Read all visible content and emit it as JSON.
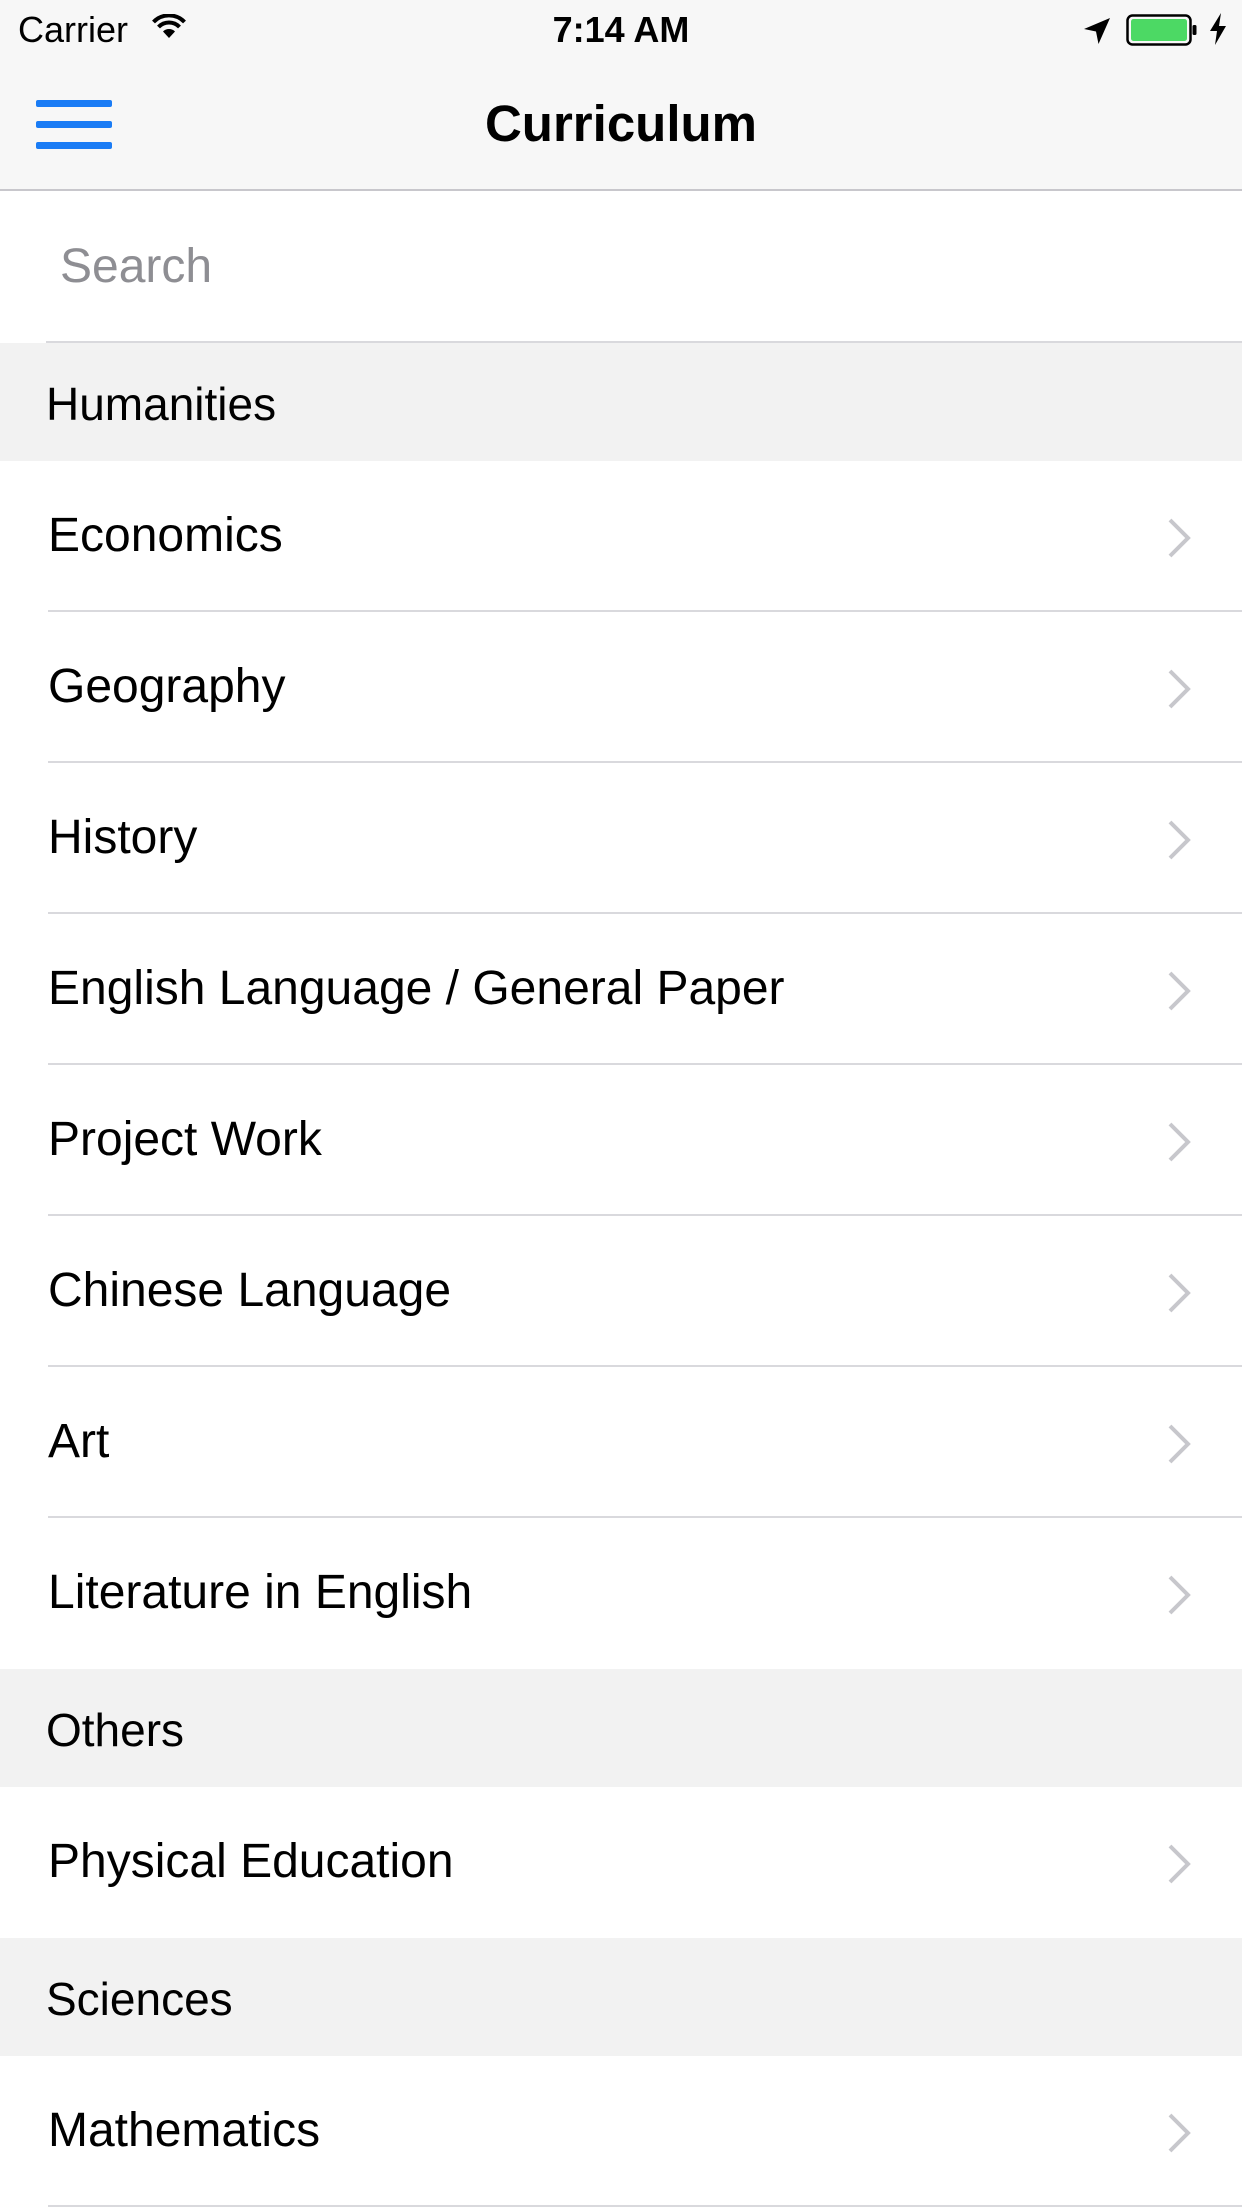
{
  "status_bar": {
    "carrier": "Carrier",
    "time": "7:14 AM",
    "battery_color": "#4cd964"
  },
  "nav_bar": {
    "title": "Curriculum",
    "menu_icon": "hamburger-icon",
    "accent_color": "#1a7cf5"
  },
  "search": {
    "placeholder": "Search",
    "value": ""
  },
  "sections": [
    {
      "title": "Humanities",
      "items": [
        {
          "label": "Economics"
        },
        {
          "label": "Geography"
        },
        {
          "label": "History"
        },
        {
          "label": "English Language / General Paper"
        },
        {
          "label": "Project Work"
        },
        {
          "label": "Chinese Language"
        },
        {
          "label": "Art"
        },
        {
          "label": "Literature in English"
        }
      ]
    },
    {
      "title": "Others",
      "items": [
        {
          "label": "Physical Education"
        }
      ]
    },
    {
      "title": "Sciences",
      "items": [
        {
          "label": "Mathematics"
        }
      ]
    }
  ]
}
